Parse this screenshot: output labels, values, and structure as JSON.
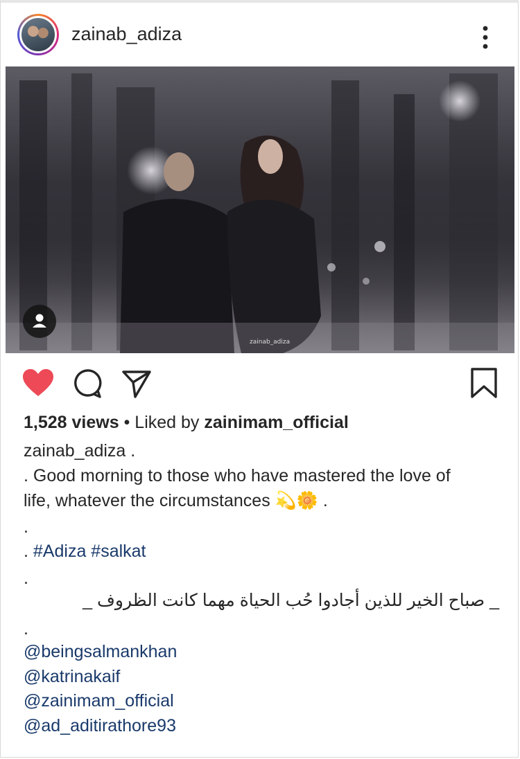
{
  "post": {
    "username": "zainab_adiza",
    "media": {
      "watermark": "zainab_adiza"
    },
    "stats": {
      "views": "1,528 views",
      "separator": "•",
      "liked_by_prefix": "Liked by",
      "liked_by_user": "zainimam_official"
    },
    "caption": {
      "author": "zainab_adiza",
      "author_suffix": ".",
      "line1": ". Good morning to those who have mastered the love of",
      "line2": "life, whatever the circumstances",
      "emoji": "💫🌼",
      "line2_end": ".",
      "dot1": ".",
      "hashtags_prefix": ".",
      "hashtags": "#Adiza #salkat",
      "dot2": ".",
      "arabic": "_ صباح الخير للذين أجادوا حُب الحياة مهما كانت الظروف _",
      "dot3": ".",
      "mentions": [
        "@beingsalmankhan",
        "@katrinakaif",
        "@zainimam_official",
        "@ad_aditirathore93"
      ]
    }
  },
  "icons": {
    "more": "more-vertical-icon",
    "user_tag": "user-tag-icon",
    "like": "heart-filled-icon",
    "comment": "comment-icon",
    "share": "share-paper-plane-icon",
    "save": "bookmark-icon"
  },
  "colors": {
    "like": "#ed4956",
    "text": "#262626",
    "link": "#1a3a6b"
  }
}
